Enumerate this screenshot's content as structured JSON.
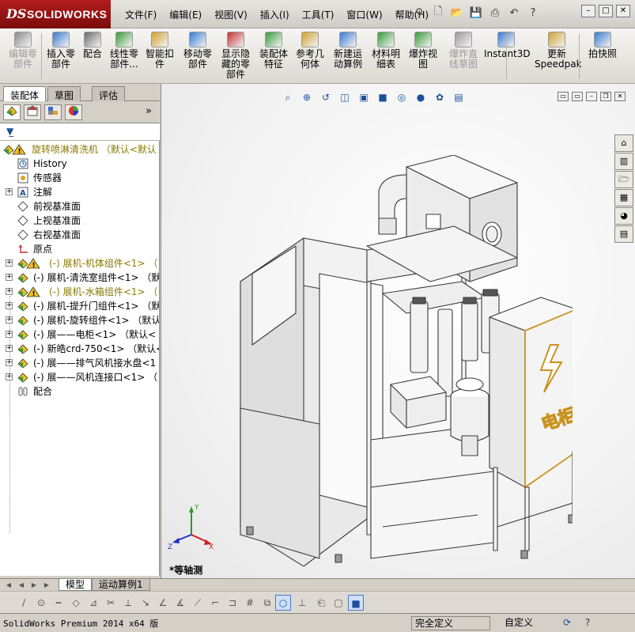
{
  "app": {
    "logo_ds": "DS",
    "logo_text": "SOLIDWORKS",
    "menu": [
      "文件(F)",
      "编辑(E)",
      "视图(V)",
      "插入(I)",
      "工具(T)",
      "窗口(W)",
      "帮助(H)"
    ]
  },
  "quick_access": [
    "new-icon",
    "open-icon",
    "save-icon",
    "print-icon",
    "undo-icon",
    "help-icon"
  ],
  "commands": [
    {
      "label": "编辑零\n部件",
      "disabled": true
    },
    {
      "label": "插入零\n部件",
      "disabled": false
    },
    {
      "label": "配合",
      "disabled": false
    },
    {
      "label": "线性零\n部件...",
      "disabled": false
    },
    {
      "label": "智能扣\n件",
      "disabled": false
    },
    {
      "label": "移动零\n部件",
      "disabled": false
    },
    {
      "label": "显示隐\n藏的零\n部件",
      "disabled": false
    },
    {
      "label": "装配体\n特征",
      "disabled": false
    },
    {
      "label": "参考几\n何体",
      "disabled": false
    },
    {
      "label": "新建运\n动算例",
      "disabled": false
    },
    {
      "label": "材料明\n细表",
      "disabled": false
    },
    {
      "label": "爆炸视\n图",
      "disabled": false
    },
    {
      "label": "爆炸直\n线草图",
      "disabled": true
    },
    {
      "label": "Instant3D",
      "disabled": false
    },
    {
      "label": "更新\nSpeedpak",
      "disabled": false
    },
    {
      "label": "拍快照",
      "disabled": false
    }
  ],
  "panel_tabs": [
    "装配体",
    "草图",
    "评估"
  ],
  "tree": {
    "root": "旋转喷淋清洗机 （默认<默认",
    "items": [
      {
        "label": "History",
        "icon": "history-icon",
        "expand": false
      },
      {
        "label": "传感器",
        "icon": "sensor-icon",
        "expand": false
      },
      {
        "label": "注解",
        "icon": "annotation-icon",
        "expand": true
      },
      {
        "label": "前视基准面",
        "icon": "plane-icon",
        "expand": false
      },
      {
        "label": "上视基准面",
        "icon": "plane-icon",
        "expand": false
      },
      {
        "label": "右视基准面",
        "icon": "plane-icon",
        "expand": false
      },
      {
        "label": "原点",
        "icon": "origin-icon",
        "expand": false
      },
      {
        "label": "(-) 展机-机体组件<1> （",
        "icon": "warning-assembly-icon",
        "expand": true,
        "olive": true
      },
      {
        "label": "(-) 展机-清洗室组件<1> （默",
        "icon": "assembly-icon",
        "expand": true
      },
      {
        "label": "(-) 展机-水箱组件<1> （",
        "icon": "warning-assembly-icon",
        "expand": true,
        "olive": true
      },
      {
        "label": "(-) 展机-提升门组件<1> （默",
        "icon": "assembly-icon",
        "expand": true
      },
      {
        "label": "(-) 展机-旋转组件<1> （默认",
        "icon": "assembly-icon",
        "expand": true
      },
      {
        "label": "(-) 展——电柜<1> （默认<",
        "icon": "assembly-icon",
        "expand": true
      },
      {
        "label": "(-) 新皓crd-750<1> （默认<",
        "icon": "assembly-icon",
        "expand": true
      },
      {
        "label": "(-) 展——排气风机接水盘<1",
        "icon": "assembly-icon",
        "expand": true
      },
      {
        "label": "(-) 展——风机连接口<1> （",
        "icon": "assembly-icon",
        "expand": true
      },
      {
        "label": "配合",
        "icon": "mates-icon",
        "expand": false
      }
    ]
  },
  "viewport": {
    "view_name": "*等轴测",
    "triad_x": "X",
    "triad_y": "Y",
    "triad_z": "Z",
    "cabinet_label": "电柜"
  },
  "bottom_tabs": [
    "模型",
    "运动算例1"
  ],
  "status": {
    "product": "SolidWorks Premium 2014 x64 版",
    "definition": "完全定义",
    "units": "自定义"
  },
  "colors": {
    "accent": "#1a4f9a",
    "logo_red": "#b41c1c",
    "warning": "#e8b400",
    "olive_text": "#8a7a00",
    "cabinet_edge": "#c99320"
  }
}
